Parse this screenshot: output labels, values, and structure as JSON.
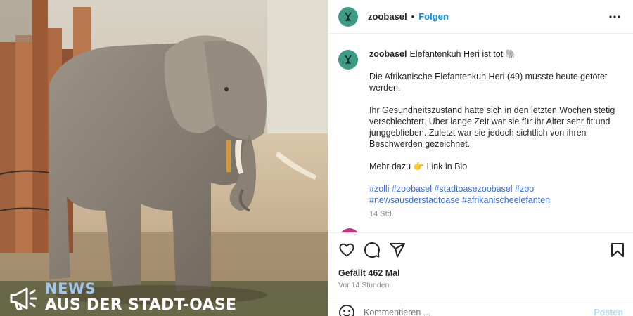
{
  "photo": {
    "overlay_line1": "NEWS",
    "overlay_line2": "AUS DER STADT-OASE"
  },
  "header": {
    "username": "zoobasel",
    "separator": "•",
    "follow_label": "Folgen",
    "more_icon": "more-horizontal-icon"
  },
  "caption": {
    "username": "zoobasel",
    "title": "Elefantenkuh Heri ist tot 🐘",
    "paragraphs": [
      "Die Afrikanische Elefantenkuh Heri (49) musste heute getötet werden.",
      "Ihr Gesundheitszustand hatte sich in den letzten Wochen stetig verschlechtert. Über lange Zeit war sie für ihr Alter sehr fit und junggeblieben. Zuletzt war sie jedoch sichtlich von ihren Beschwerden gezeichnet.",
      "Mehr dazu 👉 Link in Bio"
    ],
    "hashtags": [
      "#zolli",
      "#zoobasel",
      "#stadtoasezoobasel",
      "#zoo",
      "#newsausderstadtoase",
      "#afrikanischeelefanten"
    ],
    "time": "14 Std."
  },
  "actions": {
    "like_icon": "heart-icon",
    "comment_icon": "comment-icon",
    "share_icon": "send-icon",
    "save_icon": "bookmark-icon",
    "likes": "Gefällt 462 Mal",
    "posted_ago": "Vor 14 Stunden"
  },
  "comment": {
    "placeholder": "Kommentieren ...",
    "post_label": "Posten",
    "emoji_icon": "smiley-icon"
  },
  "colors": {
    "accent": "#0095f6",
    "avatar": "#3f9a86",
    "hashtag": "#3a6ed8"
  }
}
